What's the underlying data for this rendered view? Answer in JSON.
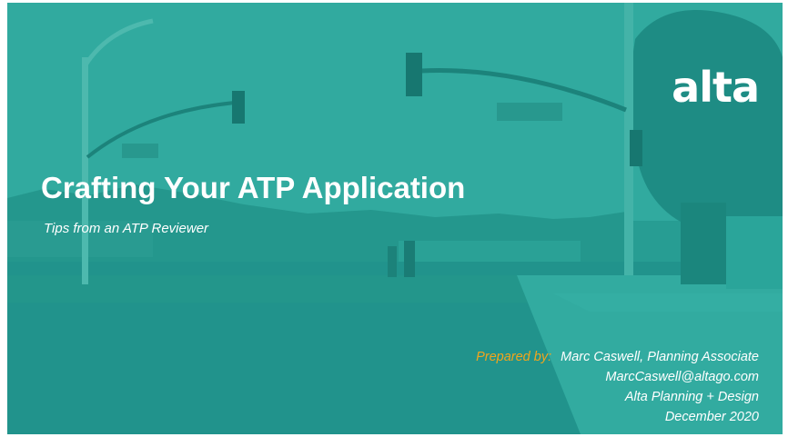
{
  "slide": {
    "logo": "alta",
    "title": "Crafting Your ATP Application",
    "subtitle": "Tips from an ATP Reviewer",
    "prepared_label": "Prepared by:",
    "author_line": "Marc Caswell, Planning Associate",
    "email": "MarcCaswell@altago.com",
    "organization": "Alta Planning + Design",
    "date": "December 2020"
  },
  "colors": {
    "background_teal": "#2a9d93",
    "accent_orange": "#f2a51c",
    "text_white": "#ffffff"
  }
}
